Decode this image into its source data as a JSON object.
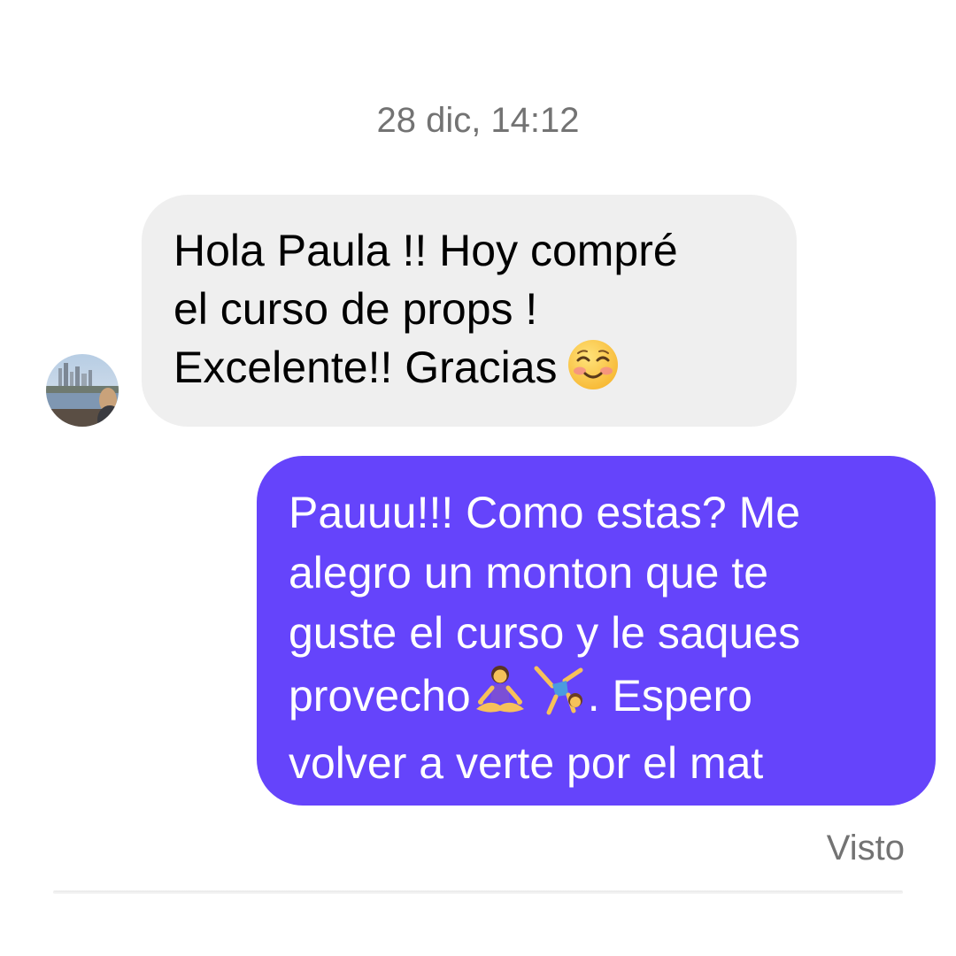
{
  "thread": {
    "timestamp": "28 dic, 14:12",
    "incoming": {
      "lines": [
        "Hola Paula !! Hoy compré",
        "el curso de props !",
        "Excelente!! Gracias"
      ],
      "emoji": "smiling-face-with-smiling-eyes",
      "bubble_color": "#efefef"
    },
    "outgoing": {
      "lines": [
        "Pauuu!!! Como estas? Me",
        "alegro un monton que te",
        "guste el curso y le saques",
        "provecho",
        ". Espero",
        "volver a verte por el mat"
      ],
      "emojis": [
        "woman-in-lotus-position",
        "person-cartwheeling"
      ],
      "bubble_color": "#6544fb"
    },
    "status": "Visto"
  }
}
